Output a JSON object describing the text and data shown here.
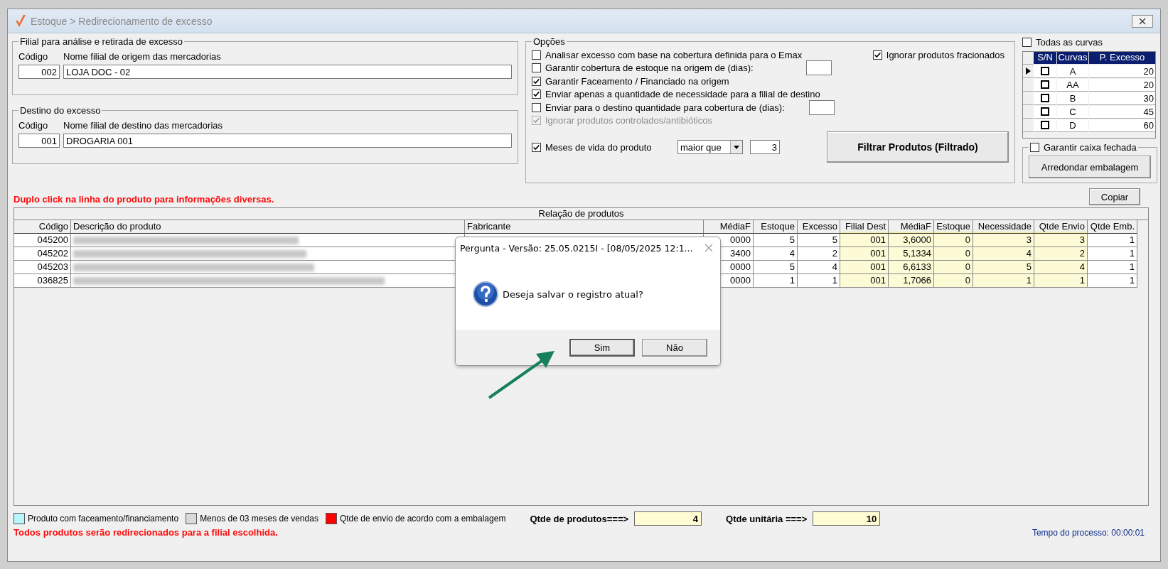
{
  "window": {
    "title": "Estoque > Redirecionamento de excesso"
  },
  "origin": {
    "legend": "Filial para análise e retirada de excesso",
    "code_label": "Código",
    "name_label": "Nome filial de origem das mercadorias",
    "code": "002",
    "name": "LOJA DOC - 02"
  },
  "destination": {
    "legend": "Destino do excesso",
    "code_label": "Código",
    "name_label": "Nome filial de destino das mercadorias",
    "code": "001",
    "name": "DROGARIA 001"
  },
  "options": {
    "legend": "Opções",
    "checks": [
      {
        "kind": "check",
        "label": "Analisar excesso com base na cobertura definida para o Emax",
        "checked": false,
        "disabled": false
      },
      {
        "kind": "days",
        "label": "Garantir cobertura de estoque na origem de (dias):",
        "checked": false,
        "disabled": false
      },
      {
        "kind": "check",
        "label": "Garantir Faceamento / Financiado na origem",
        "checked": true,
        "disabled": false
      },
      {
        "kind": "check",
        "label": "Enviar apenas a quantidade de necessidade para a filial de destino",
        "checked": true,
        "disabled": false
      },
      {
        "kind": "days",
        "label": "Enviar para o destino quantidade para cobertura de (dias):",
        "checked": false,
        "disabled": false
      },
      {
        "kind": "check",
        "label": "Ignorar produtos controlados/antibióticos",
        "checked": true,
        "disabled": true
      }
    ],
    "fractional": {
      "label": "Ignorar produtos fracionados",
      "checked": true
    },
    "months": {
      "label": "Meses de vida do produto",
      "checked": true,
      "operator": "maior que",
      "value": "3"
    },
    "filter_button": "Filtrar Produtos (Filtrado)"
  },
  "curves": {
    "all_label": "Todas as curvas",
    "all_checked": false,
    "columns": [
      "S/N",
      "Curvas",
      "P. Excesso"
    ],
    "rows": [
      {
        "current": true,
        "checked": false,
        "curve": "A",
        "excess": "20"
      },
      {
        "current": false,
        "checked": false,
        "curve": "AA",
        "excess": "20"
      },
      {
        "current": false,
        "checked": false,
        "curve": "B",
        "excess": "30"
      },
      {
        "current": false,
        "checked": false,
        "curve": "C",
        "excess": "45"
      },
      {
        "current": false,
        "checked": false,
        "curve": "D",
        "excess": "60"
      }
    ]
  },
  "closed_box": {
    "label": "Garantir caixa fechada",
    "checked": false,
    "button": "Arredondar embalagem"
  },
  "hint": "Duplo click na linha do produto para informações diversas.",
  "copy_button": "Copiar",
  "table": {
    "caption": "Relação de produtos",
    "columns": [
      {
        "label": "Código",
        "kind": "text",
        "highlight": false
      },
      {
        "label": "Descrição do produto",
        "kind": "blurred",
        "highlight": false
      },
      {
        "label": "Fabricante",
        "kind": "covered",
        "highlight": false
      },
      {
        "label": "MédiaF",
        "kind": "text",
        "highlight": false
      },
      {
        "label": "Estoque",
        "kind": "text",
        "highlight": false
      },
      {
        "label": "Excesso",
        "kind": "text",
        "highlight": false
      },
      {
        "label": "Filial Dest",
        "kind": "text",
        "highlight": true
      },
      {
        "label": "MédiaF",
        "kind": "text",
        "highlight": true
      },
      {
        "label": "Estoque",
        "kind": "text",
        "highlight": true
      },
      {
        "label": "Necessidade",
        "kind": "text",
        "highlight": true
      },
      {
        "label": "Qtde Envio",
        "kind": "text",
        "highlight": true
      },
      {
        "label": "Qtde Emb.",
        "kind": "text",
        "highlight": false
      }
    ],
    "rows": [
      {
        "cells": [
          "045200",
          null,
          null,
          "0000",
          "5",
          "5",
          "001",
          "3,6000",
          "0",
          "3",
          "3",
          "1"
        ]
      },
      {
        "cells": [
          "045202",
          null,
          null,
          "3400",
          "4",
          "2",
          "001",
          "5,1334",
          "0",
          "4",
          "2",
          "1"
        ]
      },
      {
        "cells": [
          "045203",
          null,
          null,
          "0000",
          "5",
          "4",
          "001",
          "6,6133",
          "0",
          "5",
          "4",
          "1"
        ]
      },
      {
        "cells": [
          "036825",
          null,
          null,
          "0000",
          "1",
          "1",
          "001",
          "1,7066",
          "0",
          "1",
          "1",
          "1"
        ]
      }
    ]
  },
  "legend": [
    {
      "label": "Produto com faceamento/financiamento",
      "color": "#b9f5fd"
    },
    {
      "label": "Menos de 03 meses de vendas",
      "color": "#d9d9d9"
    },
    {
      "label": "Qtde de envio de acordo com a embalagem",
      "color": "#ff0000"
    }
  ],
  "totals": [
    {
      "label": "Qtde de produtos===>",
      "value": "4"
    },
    {
      "label": "Qtde unitária ===>",
      "value": "10"
    }
  ],
  "footer_note": "Todos produtos serão redirecionados para a filial escolhida.",
  "process_time": "Tempo do processo: 00:00:01",
  "dialog": {
    "title": "Pergunta - Versão: 25.05.0215I - [08/05/2025 12:1...",
    "message": "Deseja salvar o registro atual?",
    "buttons": [
      {
        "label": "Sim",
        "selected": true
      },
      {
        "label": "Não",
        "selected": false
      }
    ]
  }
}
